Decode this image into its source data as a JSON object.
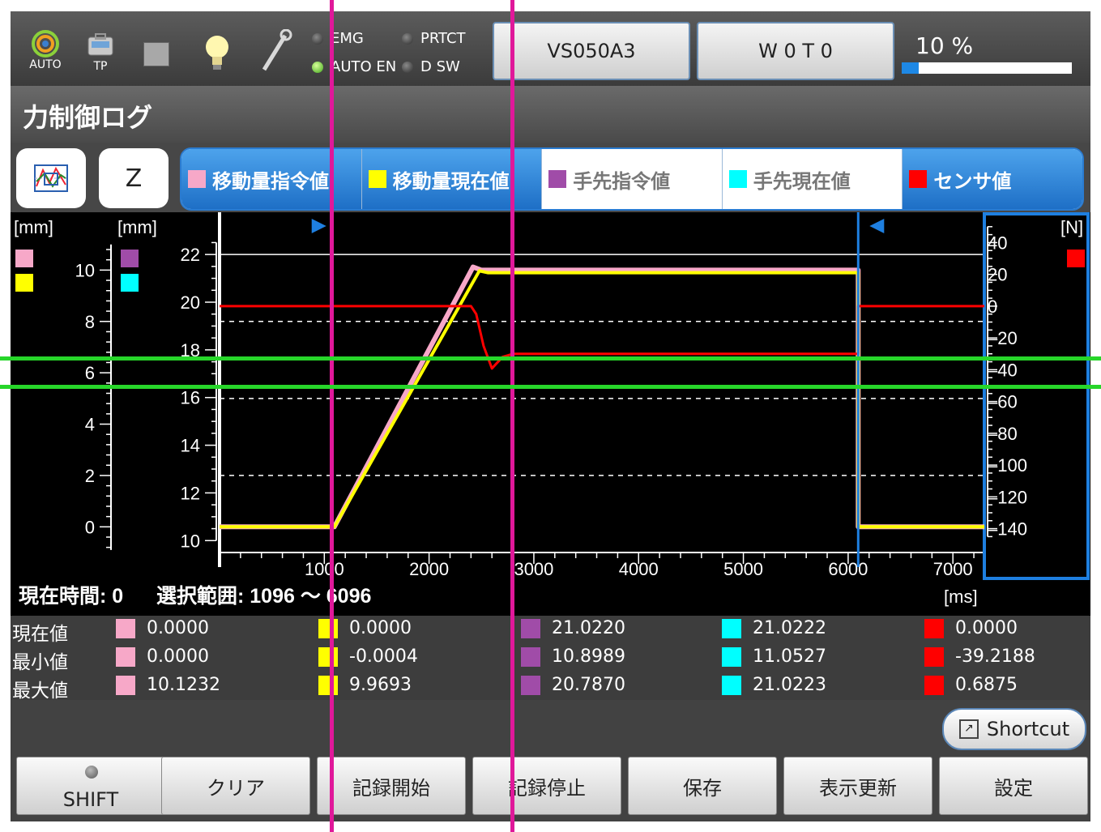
{
  "topbar": {
    "auto_label": "AUTO",
    "tp_label": "TP",
    "status": {
      "emg": "EMG",
      "prtct": "PRTCT",
      "auto_en": "AUTO EN",
      "dsw": "D SW"
    },
    "robot_button": "VS050A3",
    "work_button": "W 0 T 0",
    "speed_text": "10 %",
    "speed_percent": 10
  },
  "page_title": "力制御ログ",
  "selector": {
    "axis_button": "Z"
  },
  "legend": [
    {
      "label": "移動量指令値",
      "color": "#f7a8c8",
      "state": "active"
    },
    {
      "label": "移動量現在値",
      "color": "#ffff00",
      "state": "active"
    },
    {
      "label": "手先指令値",
      "color": "#a04ca8",
      "state": "inactive"
    },
    {
      "label": "手先現在値",
      "color": "#00ffff",
      "state": "inactive"
    },
    {
      "label": "センサ値",
      "color": "#ff0000",
      "state": "sensor"
    }
  ],
  "chart_data": {
    "type": "line",
    "xlabel": "[ms]",
    "axis1_label": "[mm]",
    "axis2_label": "[mm]",
    "axis3_label": "[N]",
    "xlim": [
      0,
      7300
    ],
    "x_ticks": [
      1000,
      2000,
      3000,
      4000,
      5000,
      6000,
      7000
    ],
    "y1_ticks": [
      0,
      2,
      4,
      6,
      8,
      10
    ],
    "y1_range": [
      -1,
      12
    ],
    "y2_ticks": [
      10,
      12,
      14,
      16,
      18,
      20,
      22
    ],
    "y2_range": [
      9.5,
      23.5
    ],
    "y3_ticks": [
      40,
      20,
      0,
      -20,
      -40,
      -60,
      -80,
      -100,
      -120,
      -140
    ],
    "y3_range": [
      -155,
      55
    ],
    "selection_start": 1096,
    "selection_end": 6096,
    "series": [
      {
        "name": "移動量指令値",
        "axis": "y1",
        "color": "#f7a8c8",
        "x": [
          0,
          1096,
          2420,
          2500,
          6096,
          6096,
          7300
        ],
        "y": [
          0,
          0,
          10.12,
          10.0,
          10.0,
          0,
          0
        ]
      },
      {
        "name": "移動量現在値",
        "axis": "y1",
        "color": "#ffff00",
        "x": [
          0,
          1096,
          2480,
          2560,
          6096,
          6096,
          7300
        ],
        "y": [
          0,
          0,
          9.97,
          9.9,
          9.9,
          0,
          0
        ]
      },
      {
        "name": "センサ値",
        "axis": "y3",
        "color": "#ff0000",
        "x": [
          0,
          2400,
          2450,
          2520,
          2600,
          2700,
          2800,
          2900,
          6096,
          6096,
          7300
        ],
        "y": [
          0,
          0,
          -5,
          -25,
          -39.2,
          -32,
          -30,
          -30,
          -30,
          0,
          0
        ]
      }
    ]
  },
  "status_line": {
    "current_time": "現在時間: 0",
    "range": "選択範囲: 1096 ～ 6096"
  },
  "stats": {
    "rows": [
      {
        "label": "現在値",
        "values": [
          "0.0000",
          "0.0000",
          "21.0220",
          "21.0222",
          "0.0000"
        ]
      },
      {
        "label": "最小値",
        "values": [
          "0.0000",
          "-0.0004",
          "10.8989",
          "11.0527",
          "-39.2188"
        ]
      },
      {
        "label": "最大値",
        "values": [
          "10.1232",
          "9.9693",
          "20.7870",
          "21.0223",
          "0.6875"
        ]
      }
    ]
  },
  "shortcut_label": "Shortcut",
  "function_buttons": [
    "SHIFT",
    "クリア",
    "記録開始",
    "記録停止",
    "保存",
    "表示更新",
    "設定"
  ]
}
